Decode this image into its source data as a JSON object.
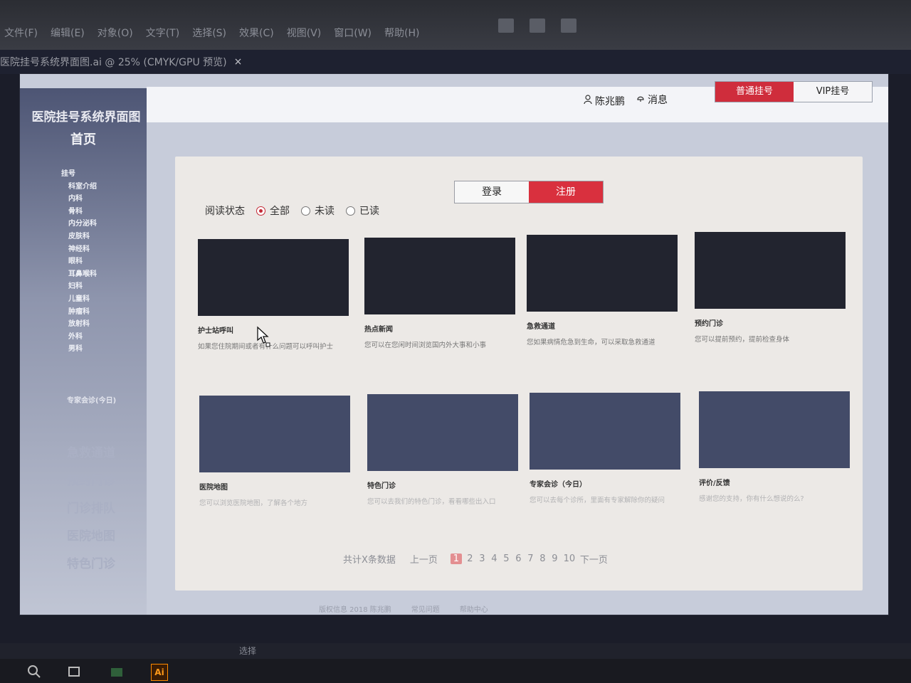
{
  "app": {
    "menu": [
      "文件(F)",
      "编辑(E)",
      "对象(O)",
      "文字(T)",
      "选择(S)",
      "效果(C)",
      "视图(V)",
      "窗口(W)",
      "帮助(H)"
    ],
    "doc_tab": "医院挂号系统界面图.ai @ 25% (CMYK/GPU 预览)",
    "doc_close": "×",
    "status_tool": "选择",
    "taskbar_app": "Ai"
  },
  "sidebar": {
    "app_title": "医院挂号系统界面图",
    "home": "首页",
    "items": [
      {
        "label": "挂号",
        "level": "group"
      },
      {
        "label": "科室介绍",
        "level": "sub"
      },
      {
        "label": "内科",
        "level": "item"
      },
      {
        "label": "骨科",
        "level": "item"
      },
      {
        "label": "内分泌科",
        "level": "item"
      },
      {
        "label": "皮肤科",
        "level": "item"
      },
      {
        "label": "神经科",
        "level": "item"
      },
      {
        "label": "眼科",
        "level": "item"
      },
      {
        "label": "耳鼻喉科",
        "level": "item"
      },
      {
        "label": "妇科",
        "level": "item"
      },
      {
        "label": "儿童科",
        "level": "item"
      },
      {
        "label": "肿瘤科",
        "level": "item"
      },
      {
        "label": "放射科",
        "level": "item"
      },
      {
        "label": "外科",
        "level": "item"
      },
      {
        "label": "男科",
        "level": "item"
      }
    ],
    "expert": "专家会诊(今日)",
    "big_links": [
      "急救通道",
      "预约门诊",
      "门诊排队",
      "医院地图",
      "特色门诊"
    ]
  },
  "header": {
    "user_name": "陈兆鹏",
    "messages": "消息",
    "reg_normal": "普通挂号",
    "reg_vip": "VIP挂号"
  },
  "auth": {
    "login": "登录",
    "register": "注册"
  },
  "filter": {
    "label": "阅读状态",
    "options": [
      "全部",
      "未读",
      "已读"
    ],
    "selected": "全部"
  },
  "cards": [
    {
      "title": "护士站呼叫",
      "desc": "如果您住院期间或者有什么问题可以呼叫护士"
    },
    {
      "title": "热点新闻",
      "desc": "您可以在您闲时间浏览国内外大事和小事"
    },
    {
      "title": "急救通道",
      "desc": "您如果病情危急到生命，可以采取急救通道"
    },
    {
      "title": "预约门诊",
      "desc": "您可以提前预约，提前检查身体"
    },
    {
      "title": "医院地图",
      "desc": "您可以浏览医院地图，了解各个地方"
    },
    {
      "title": "特色门诊",
      "desc": "您可以去我们的特色门诊，看看哪些出入口"
    },
    {
      "title": "专家会诊（今日）",
      "desc": "您可以去每个诊所，里面有专家解除你的疑问"
    },
    {
      "title": "评价/反馈",
      "desc": "感谢您的支持，你有什么想说的么?"
    }
  ],
  "pager": {
    "total": "共计X条数据",
    "prev": "上一页",
    "pages": [
      "1",
      "2",
      "3",
      "4",
      "5",
      "6",
      "7",
      "8",
      "9",
      "10"
    ],
    "current": "1",
    "next": "下一页"
  },
  "footer": [
    "版权信息 2018 陈兆鹏",
    "常见问题",
    "帮助中心"
  ],
  "colors": {
    "accent_red": "#d9303e",
    "thumb_dark": "#22242f",
    "thumb_blue": "#434b68"
  }
}
